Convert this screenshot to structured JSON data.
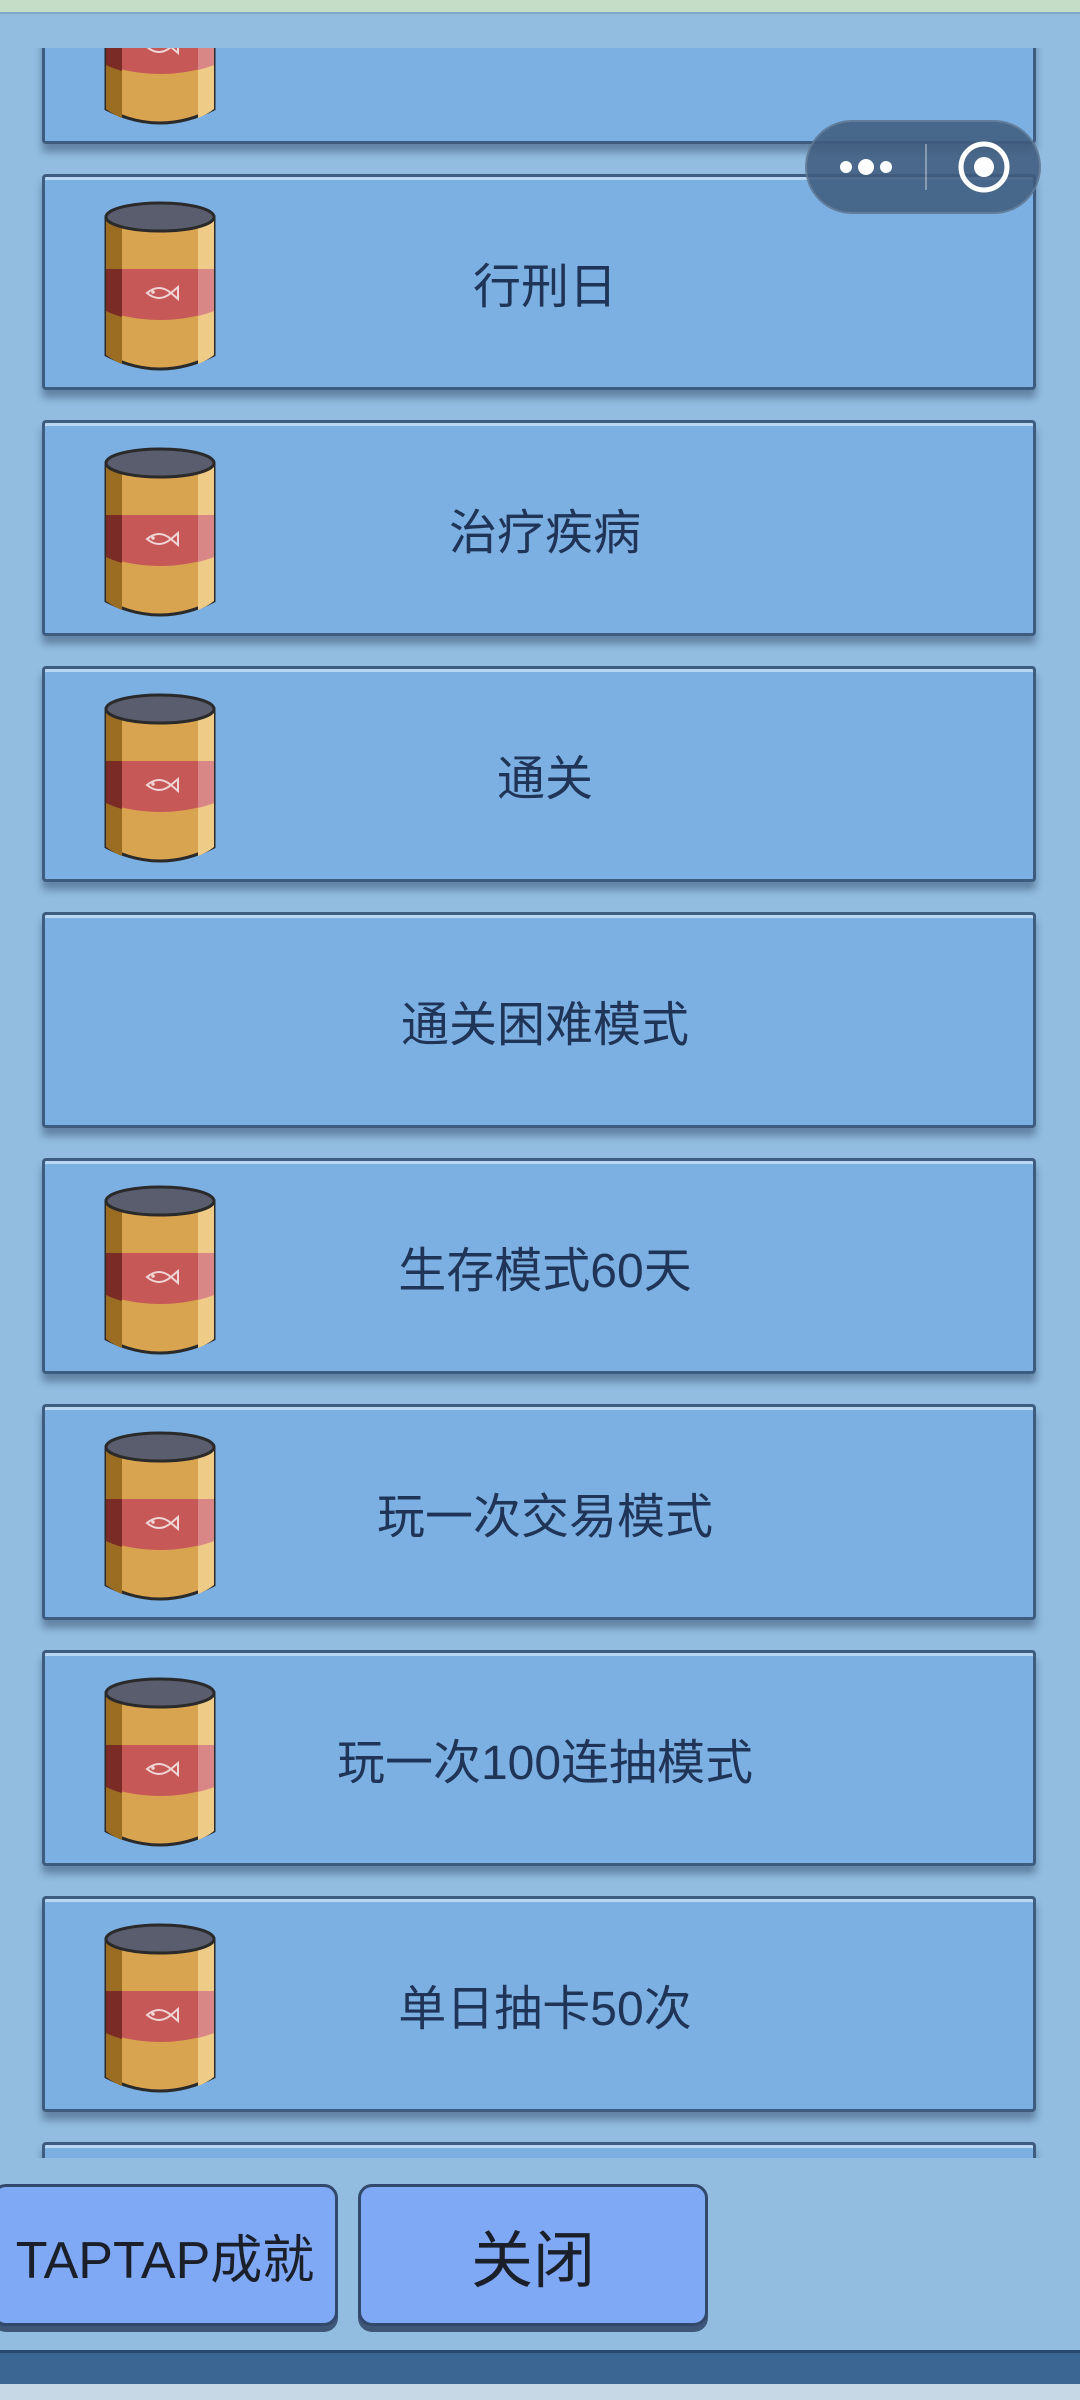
{
  "colors": {
    "background": "#92bde0",
    "card": "#7cb0e2",
    "card_border": "#3e5c7f",
    "label_text": "#1f3457",
    "button": "#7fa8f5",
    "bottom_rule": "#3b6694"
  },
  "capsule": {
    "more_icon": "more-dots-icon",
    "close_icon": "target-close-icon"
  },
  "achievements": [
    {
      "label": "",
      "reward_icon": "fish-can-icon",
      "partial": "top"
    },
    {
      "label": "行刑日",
      "reward_icon": "fish-can-icon"
    },
    {
      "label": "治疗疾病",
      "reward_icon": "fish-can-icon"
    },
    {
      "label": "通关",
      "reward_icon": "fish-can-icon"
    },
    {
      "label": "通关困难模式",
      "reward_icon": ""
    },
    {
      "label": "生存模式60天",
      "reward_icon": "fish-can-icon"
    },
    {
      "label": "玩一次交易模式",
      "reward_icon": "fish-can-icon"
    },
    {
      "label": "玩一次100连抽模式",
      "reward_icon": "fish-can-icon"
    },
    {
      "label": "单日抽卡50次",
      "reward_icon": "fish-can-icon"
    },
    {
      "label": "",
      "reward_icon": "fish-can-icon",
      "partial": "bottom"
    }
  ],
  "buttons": {
    "taptap_label": "TAPTAP成就",
    "close_label": "关闭"
  }
}
